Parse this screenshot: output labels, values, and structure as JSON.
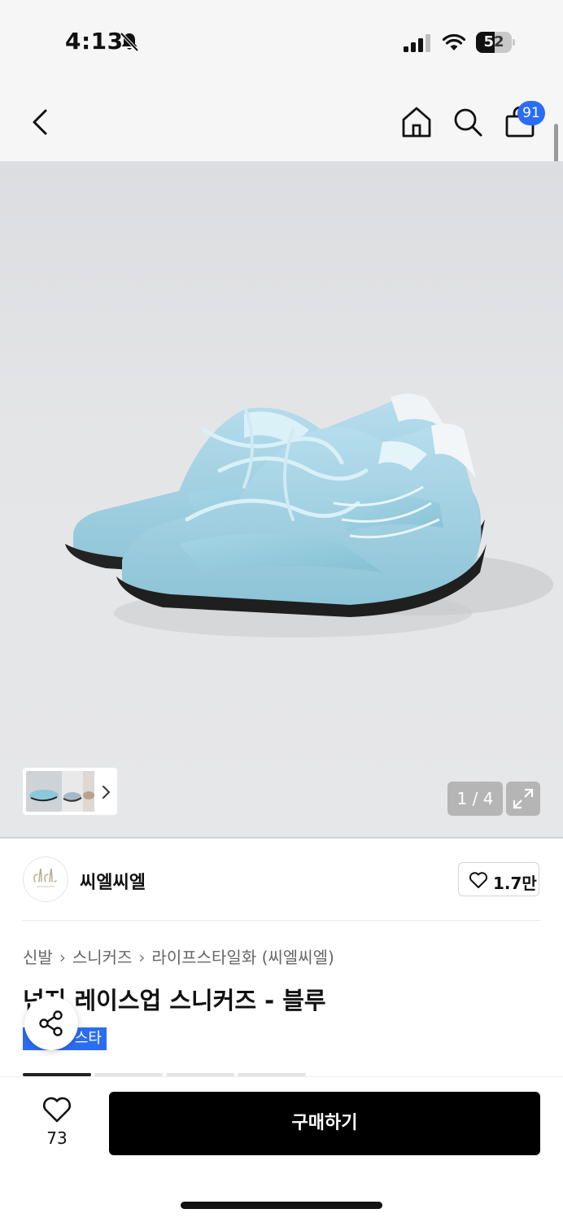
{
  "status_bar": {
    "time": "4:13",
    "battery": "52",
    "battery_level_percent": 52
  },
  "header": {
    "back_icon": "chevron-left-icon",
    "home_icon": "home-icon",
    "search_icon": "search-icon",
    "cart_icon": "shopping-bag-icon",
    "cart_badge": "91"
  },
  "gallery": {
    "counter": "1 / 4",
    "expand_icon": "expand-icon",
    "thumbnail_arrow_icon": "chevron-right-icon"
  },
  "brand": {
    "logo_text": "clcl",
    "name": "씨엘씨엘",
    "like_count": "1.7만"
  },
  "breadcrumb": [
    "신발",
    "스니커즈",
    "라이프스타일화 (씨엘씨엘)"
  ],
  "product": {
    "title": "넌지 레이스업 스니커즈 - 블루",
    "tag": "스타"
  },
  "bottom": {
    "wish_count": "73",
    "buy_label": "구매하기"
  },
  "colors": {
    "accent": "#2a6df4",
    "buy_button": "#000000",
    "shoe": "#9fd0e0",
    "sole": "#222222"
  }
}
